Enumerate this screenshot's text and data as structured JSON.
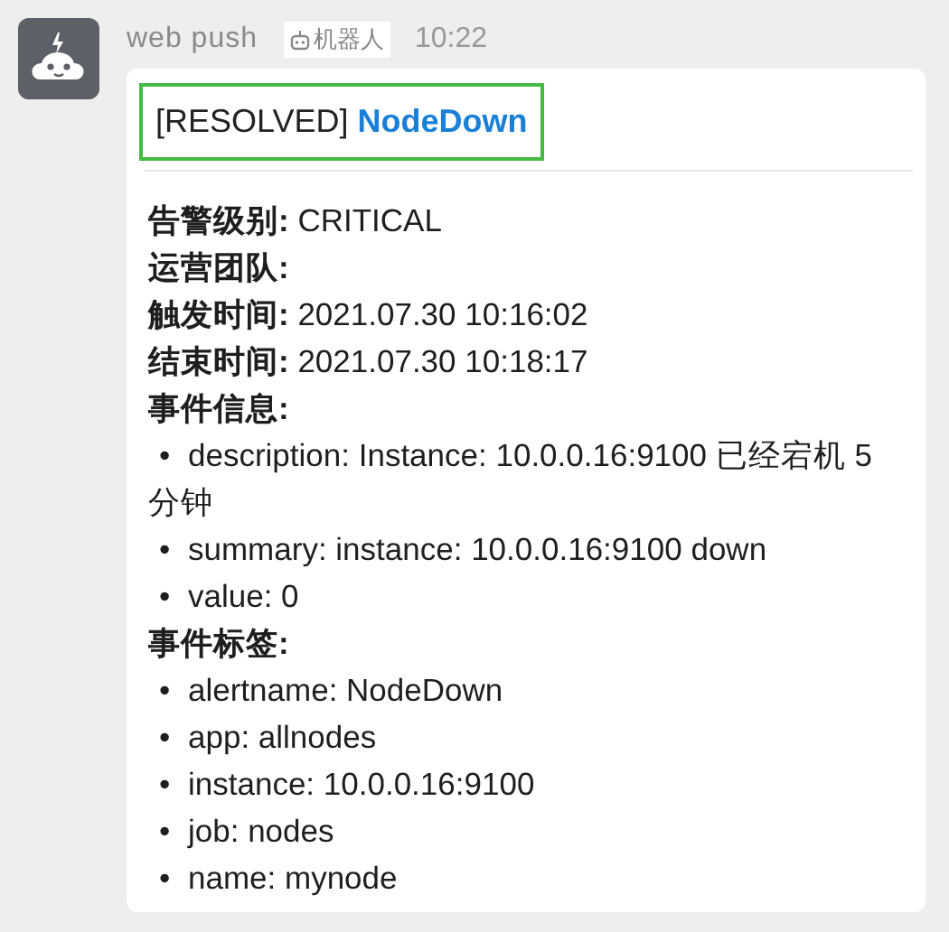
{
  "sender": {
    "name": "web push",
    "badge": "机器人",
    "time": "10:22"
  },
  "message": {
    "title": "[RESOLVED] **NodeDown**",
    "lines": [
      {
        "kind": "field",
        "text": "**告警级别:** CRITICAL"
      },
      {
        "kind": "field",
        "text": "**运营团队:**"
      },
      {
        "kind": "field",
        "text": "**触发时间:** 2021.07.30 10:16:02"
      },
      {
        "kind": "field",
        "text": "**结束时间:** 2021.07.30 10:18:17"
      },
      {
        "kind": "field",
        "text": "**事件信息:**"
      },
      {
        "kind": "bullet",
        "bullet": "•",
        "text": "description: Instance: 10.0.0.16:9100 已经宕机 5 分钟"
      },
      {
        "kind": "bullet",
        "bullet": "•",
        "text": "summary: instance: 10.0.0.16:9100 down"
      },
      {
        "kind": "bullet",
        "bullet": "•",
        "text": "value: 0"
      },
      {
        "kind": "field",
        "text": "**事件标签:**"
      },
      {
        "kind": "bullet",
        "bullet": "•",
        "text": "alertname: NodeDown"
      },
      {
        "kind": "bullet",
        "bullet": "•",
        "text": "app: allnodes"
      },
      {
        "kind": "bullet",
        "bullet": "•",
        "text": "instance: 10.0.0.16:9100"
      },
      {
        "kind": "bullet",
        "bullet": "•",
        "text": "job: nodes"
      },
      {
        "kind": "bullet",
        "bullet": "•",
        "text": "name: mynode"
      }
    ]
  }
}
